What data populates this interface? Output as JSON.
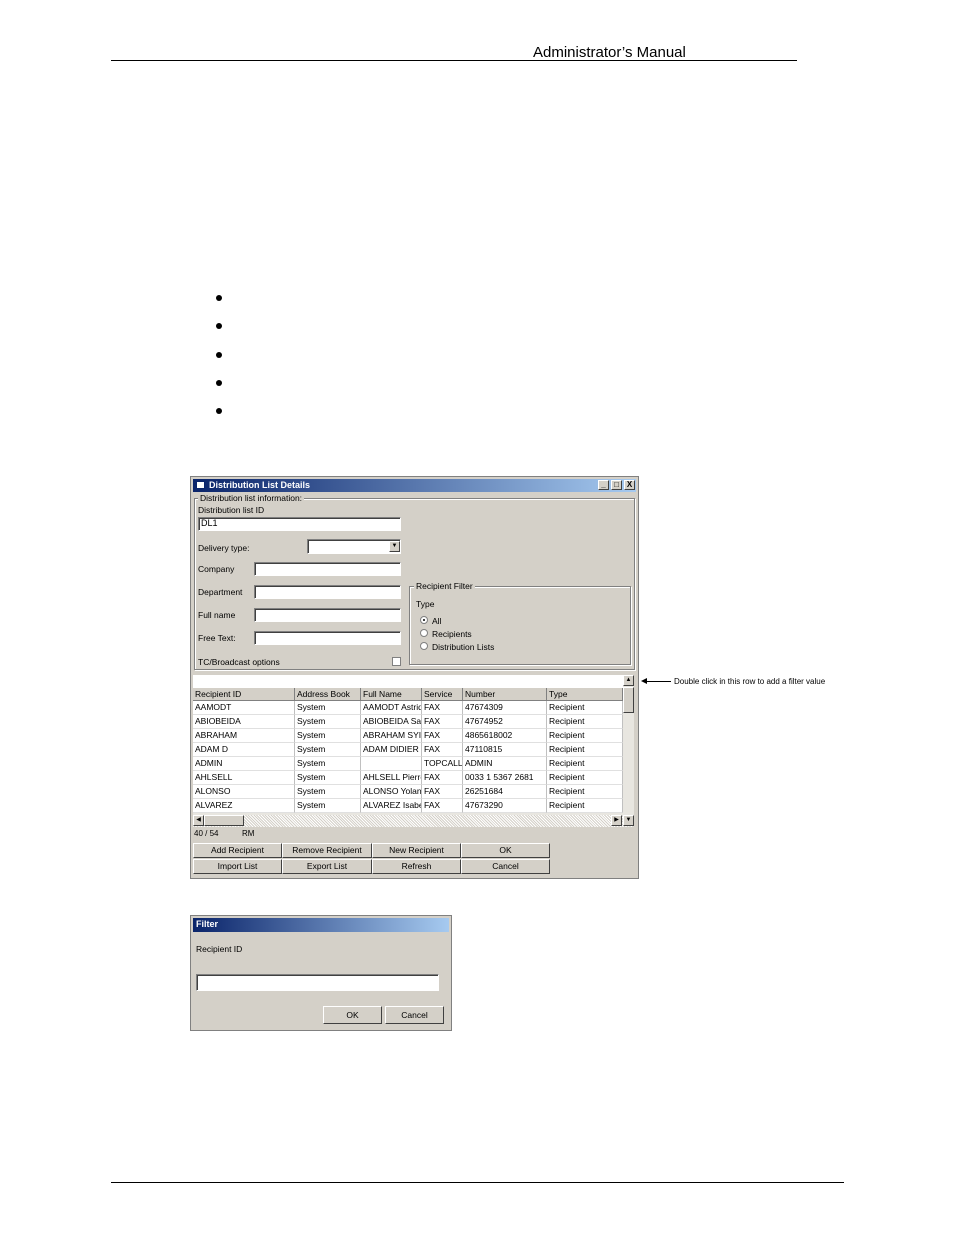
{
  "header": {
    "title": "Administrator’s Manual"
  },
  "dialog": {
    "title": "Distribution List Details",
    "title_buttons": [
      "_",
      "□",
      "X"
    ],
    "group_title": "Distribution list information:",
    "list_id_label": "Distribution list ID",
    "list_id_value": "DL1",
    "delivery_type_label": "Delivery type:",
    "delivery_type_value": "",
    "company_label": "Company",
    "department_label": "Department",
    "full_name_label": "Full name",
    "free_text_label": "Free Text:",
    "tc_broadcast_label": "TC/Broadcast options",
    "filter_group_title": "Recipient Filter",
    "filter_type_label": "Type",
    "filter_options": [
      "All",
      "Recipients",
      "Distribution Lists"
    ],
    "filter_selected": "All",
    "table": {
      "columns": [
        "Recipient ID",
        "Address Book",
        "Full Name",
        "Service",
        "Number",
        "Type"
      ],
      "rows": [
        [
          "AAMODT",
          "System",
          "AAMODT Astrid",
          "FAX",
          "47674309",
          "Recipient"
        ],
        [
          "ABIOBEIDA",
          "System",
          "ABIOBEIDA Saa",
          "FAX",
          "47674952",
          "Recipient"
        ],
        [
          "ABRAHAM",
          "System",
          "ABRAHAM SYI",
          "FAX",
          "4865618002",
          "Recipient"
        ],
        [
          "ADAM D",
          "System",
          "ADAM DIDIER",
          "FAX",
          "47110815",
          "Recipient"
        ],
        [
          "ADMIN",
          "System",
          "",
          "TOPCALL",
          "ADMIN",
          "Recipient"
        ],
        [
          "AHLSELL",
          "System",
          "AHLSELL Pierre",
          "FAX",
          "0033 1 5367 2681",
          "Recipient"
        ],
        [
          "ALONSO",
          "System",
          "ALONSO Yolan",
          "FAX",
          "26251684",
          "Recipient"
        ],
        [
          "ALVAREZ",
          "System",
          "ALVAREZ Isabe",
          "FAX",
          "47673290",
          "Recipient"
        ]
      ]
    },
    "status_count": "40 / 54",
    "status_mode": "RM",
    "buttons_row1": [
      "Add Recipient",
      "Remove Recipient",
      "New Recipient",
      "OK"
    ],
    "buttons_row2": [
      "Import List",
      "Export List",
      "Refresh",
      "Cancel"
    ]
  },
  "annotation": "Double click in this row to add a filter value",
  "filter_dialog": {
    "title": "Filter",
    "field_label": "Recipient ID",
    "field_value": "",
    "ok_label": "OK",
    "cancel_label": "Cancel"
  }
}
